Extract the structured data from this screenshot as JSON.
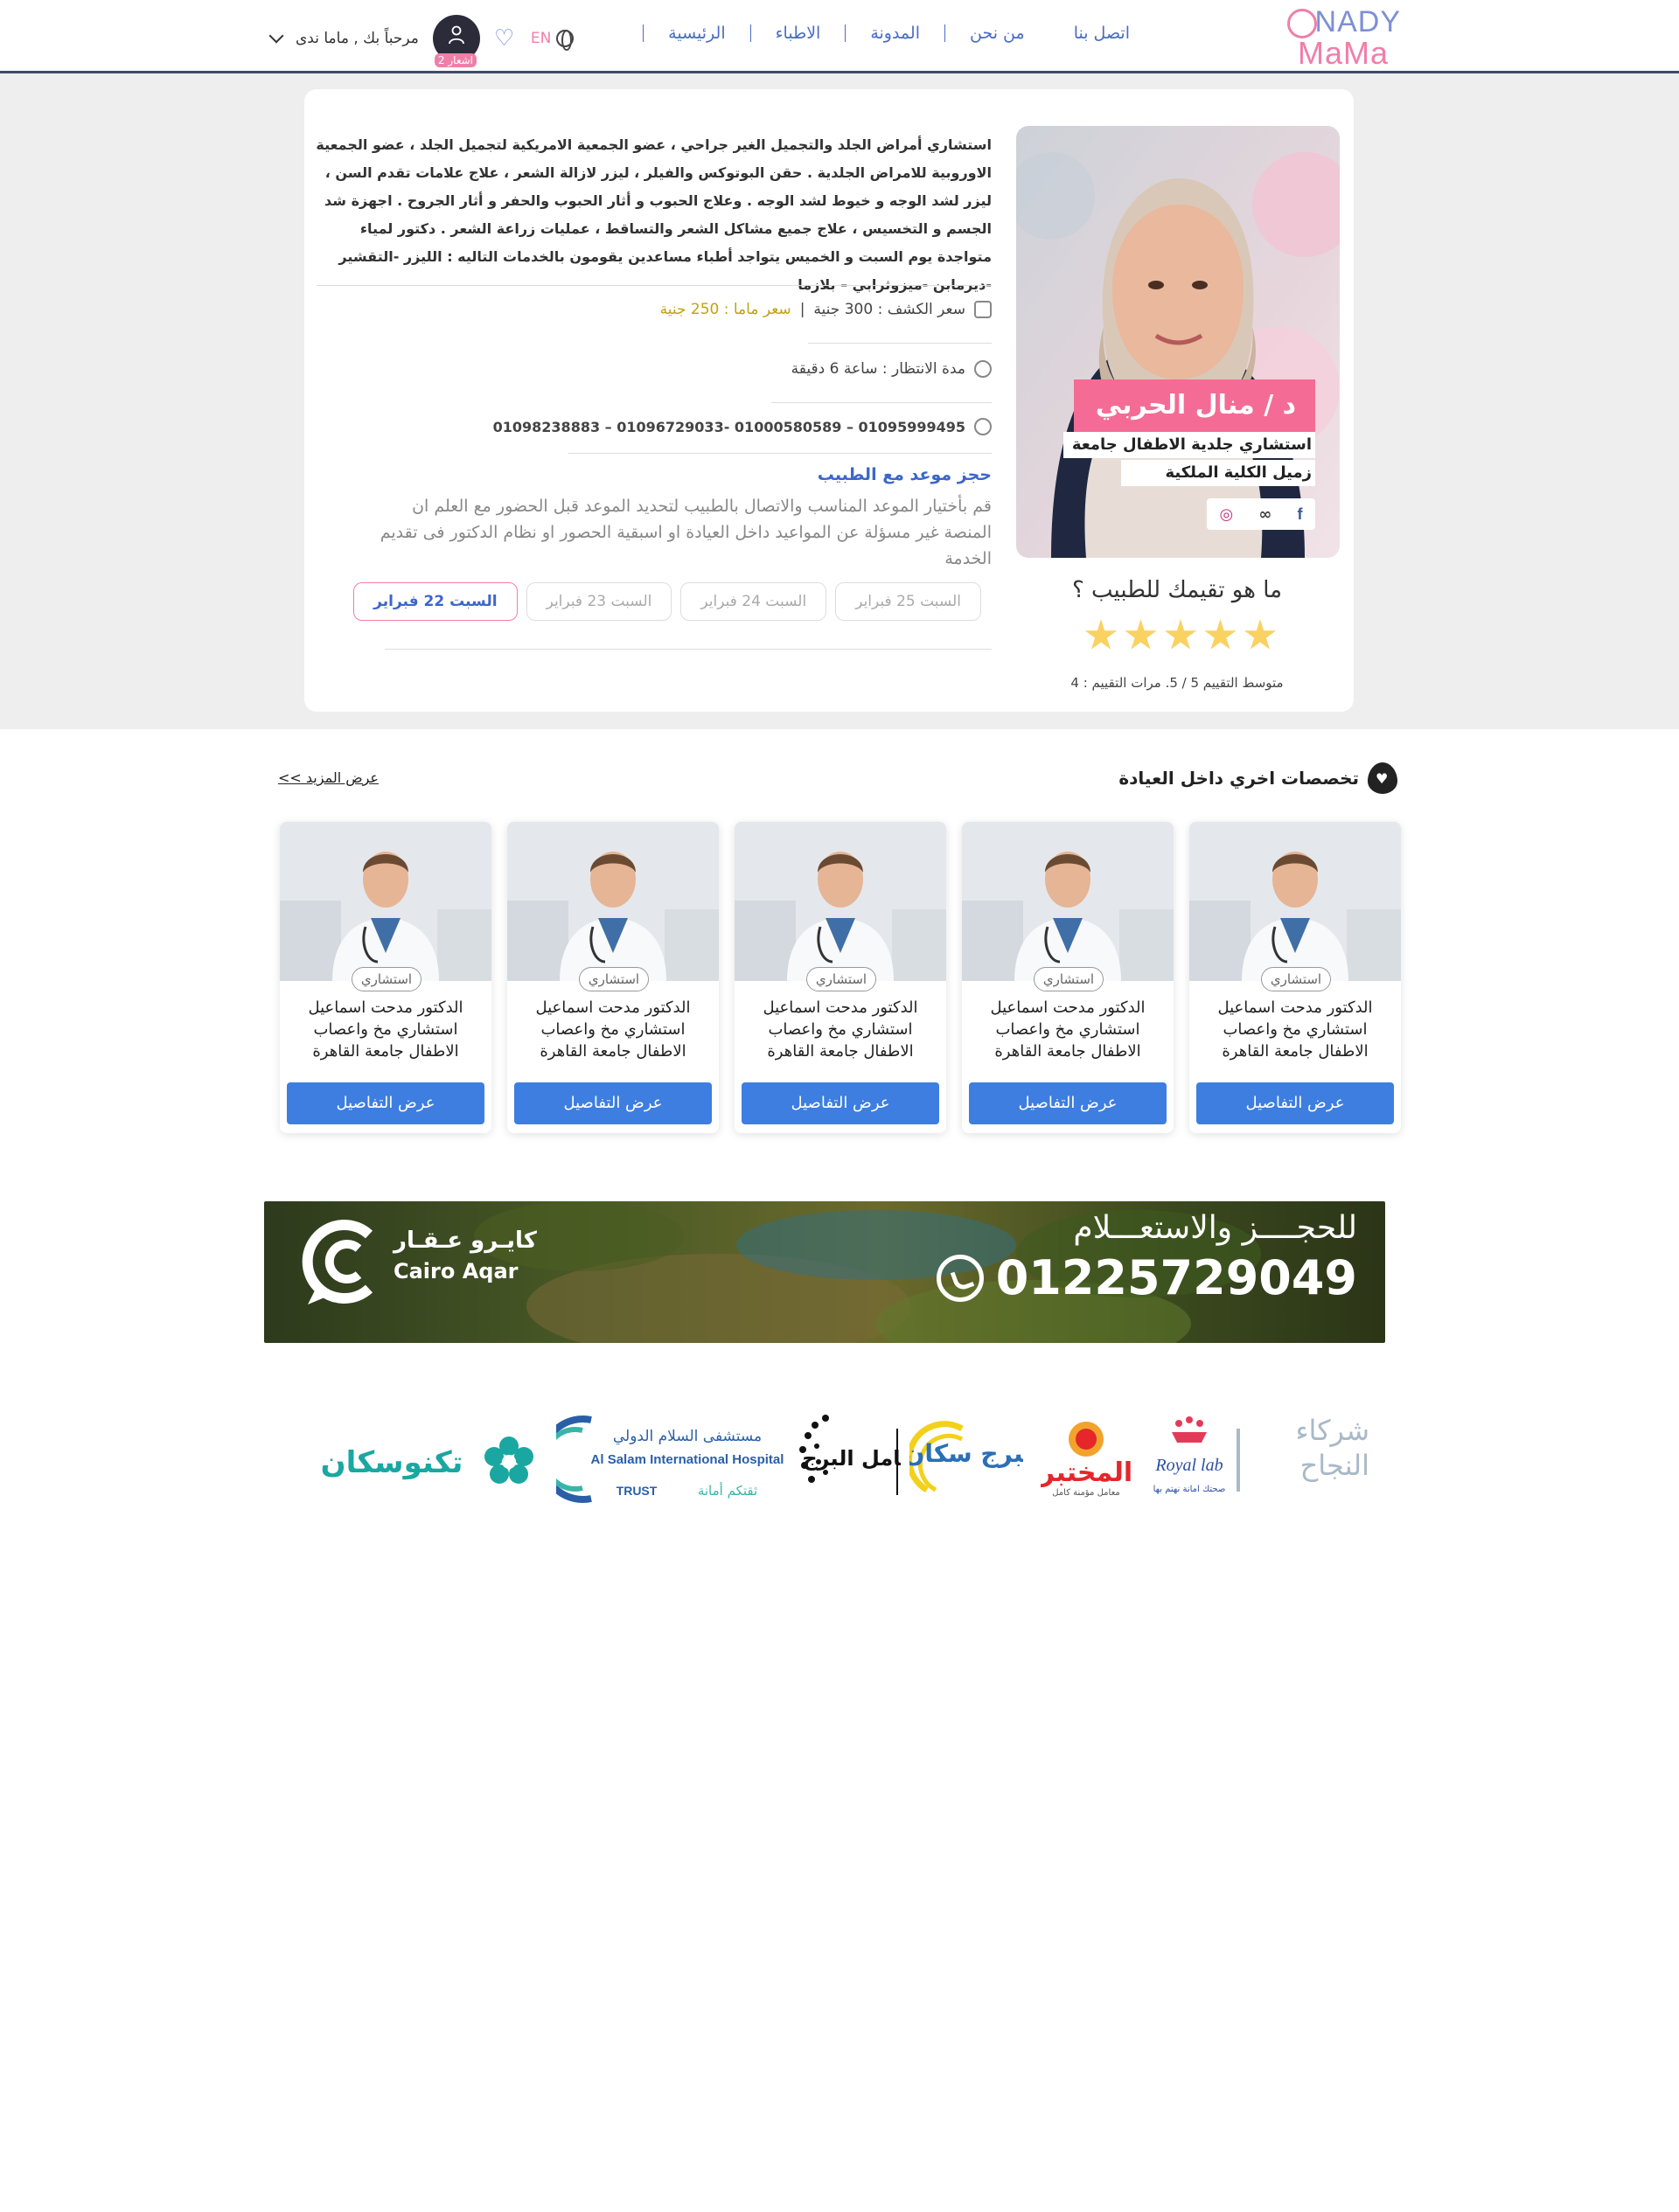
{
  "header": {
    "logo_top": "NADY",
    "logo_bottom": "MaMa",
    "nav": [
      "الرئيسية",
      "الاطباء",
      "المدونة",
      "من نحن",
      "اتصل بنا"
    ],
    "lang": "EN",
    "greeting": "مرحباً بك , ماما ندى",
    "notifications": "اشعار 2"
  },
  "doctor": {
    "name": "د / منال الحربي",
    "title1": "استشاري جلدية الاطفال جامعة الازهر",
    "title2": "زميل الكلية الملكية",
    "bio": "استشاري أمراض الجلد والتجميل الغير جراحي ، عضو الجمعية الامريكية لتجميل الجلد ، عضو الجمعية الاوروبية للامراض الجلدية . حقن البوتوكس والفيلر ، ليزر لازالة الشعر ، علاج علامات تقدم السن ، ليزر لشد الوجه و خيوط لشد الوجه . وعلاج الحبوب و أثار الحبوب والحفر و أثار الجروح . اجهزة شد الجسم و التخسيس ، علاج جميع مشاكل الشعر والتساقط ، عمليات زراعة الشعر . دكتور لمياء متواجدة يوم السبت و الخميس يتواجد أطباء مساعدين يقومون بالخدمات التاليه : الليزر -التقشير -ديرمابن -ميزوثرابي – بلازما",
    "price_label": "سعر الكشف : 300 جنية",
    "separator": "|",
    "mama_price": "سعر ماما : 250 جنية",
    "wait_time": "مدة الانتظار : ساعة 6 دقيقة",
    "phones": "01095999495 – 01000580589 -01096729033 – 01098238883",
    "booking_title": "حجز موعد مع الطبيب",
    "booking_desc": "قم بأختيار الموعد المناسب والاتصال بالطبيب لتحديد الموعد قبل الحضور مع العلم ان المنصة غير مسؤلة عن المواعيد داخل العيادة او اسبقية الحصور او نظام الدكتور فى تقديم الخدمة",
    "dates": [
      "السبت 22 فبراير",
      "السبت 23 فبراير",
      "السبت 24 فبراير",
      "السبت 25 فبراير"
    ],
    "active_date_index": 0,
    "rating_question": "ما هو تقيمك للطبيب ؟",
    "rating_stars": 5,
    "rating_summary": "متوسط التقييم 5 / 5. مرات التقييم : 4"
  },
  "other_specialties": {
    "title": "تخصصات اخري داخل العيادة",
    "more_link": "عرض المزيد >>",
    "cards": [
      {
        "badge": "استشاري",
        "name": "الدكتور مدحت اسماعيل استشاري مخ واعصاب الاطفال جامعة القاهرة",
        "button": "عرض التفاصيل"
      },
      {
        "badge": "استشاري",
        "name": "الدكتور مدحت اسماعيل استشاري مخ واعصاب الاطفال جامعة القاهرة",
        "button": "عرض التفاصيل"
      },
      {
        "badge": "استشاري",
        "name": "الدكتور مدحت اسماعيل استشاري مخ واعصاب الاطفال جامعة القاهرة",
        "button": "عرض التفاصيل"
      },
      {
        "badge": "استشاري",
        "name": "الدكتور مدحت اسماعيل استشاري مخ واعصاب الاطفال جامعة القاهرة",
        "button": "عرض التفاصيل"
      },
      {
        "badge": "استشاري",
        "name": "الدكتور مدحت اسماعيل استشاري مخ واعصاب الاطفال جامعة القاهرة",
        "button": "عرض التفاصيل"
      }
    ]
  },
  "banner": {
    "cta": "للحجــــز والاستعـــلام",
    "phone": "01225729049",
    "brand_ar": "كايـرو عـقـار",
    "brand_en": "Cairo Aqar"
  },
  "partners": {
    "title": "شركاء النجاح",
    "logos": [
      "Royal lab",
      "المختبر",
      "البرج سكان",
      "معامل البرج",
      "مستشفى السلام الدولي",
      "تكنوسكان"
    ],
    "royal_slogan": "صحتك امانة نهتم بها",
    "mokhtabar_slogan": "معامل مؤمنة كامل",
    "salam_ar": "مستشفى السلام الدولي",
    "salam_en": "Al Salam International Hospital",
    "salam_trust": "TRUST",
    "salam_slogan": "ثقتكم أمانة"
  },
  "colors": {
    "accent_blue": "#3d7ee0",
    "accent_pink": "#f46c95",
    "nav_blue": "#4a6cc8",
    "gold": "#c2a20e",
    "star": "#f9d262"
  }
}
